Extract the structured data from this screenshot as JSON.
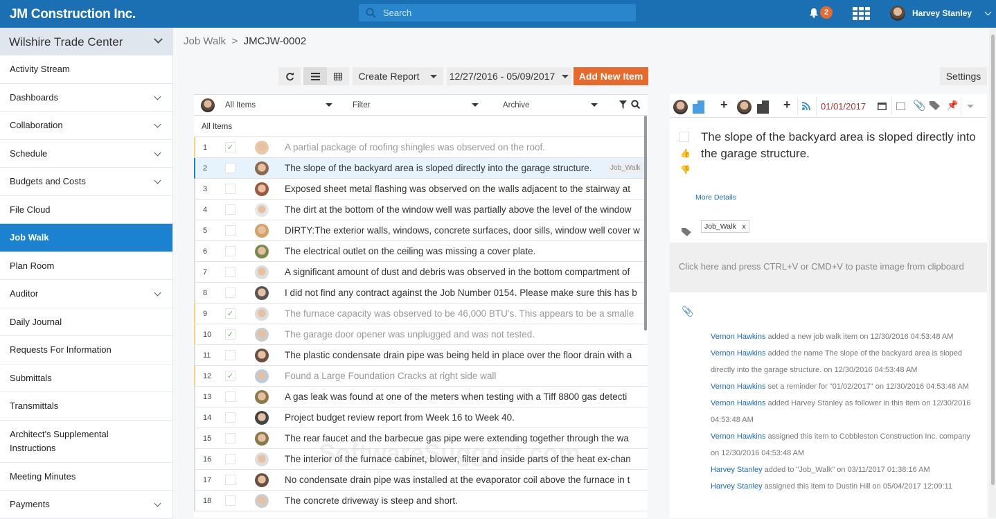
{
  "header": {
    "company": "JM Construction Inc.",
    "search_placeholder": "Search",
    "notifications": "2",
    "user": "Harvey Stanley"
  },
  "sidebar": {
    "project": "Wilshire Trade Center",
    "items": [
      {
        "label": "Activity Stream",
        "chev": false
      },
      {
        "label": "Dashboards",
        "chev": true
      },
      {
        "label": "Collaboration",
        "chev": true
      },
      {
        "label": "Schedule",
        "chev": true
      },
      {
        "label": "Budgets and Costs",
        "chev": true
      },
      {
        "label": "File Cloud",
        "chev": false
      },
      {
        "label": "Job Walk",
        "chev": false,
        "active": true
      },
      {
        "label": "Plan Room",
        "chev": false
      },
      {
        "label": "Auditor",
        "chev": true
      },
      {
        "label": "Daily Journal",
        "chev": false
      },
      {
        "label": "Requests For Information",
        "chev": false
      },
      {
        "label": "Submittals",
        "chev": false
      },
      {
        "label": "Transmittals",
        "chev": false
      },
      {
        "label": "Architect's Supplemental Instructions",
        "chev": false
      },
      {
        "label": "Meeting Minutes",
        "chev": false
      },
      {
        "label": "Payments",
        "chev": true
      }
    ]
  },
  "breadcrumb": {
    "parent": "Job Walk",
    "sep": ">",
    "current": "JMCJW-0002"
  },
  "toolbar": {
    "create_report": "Create Report",
    "date_range": "12/27/2016 - 05/09/2017",
    "add_new": "Add New Item",
    "settings": "Settings"
  },
  "list": {
    "filter1": "All Items",
    "filter2": "Filter",
    "filter3": "Archive",
    "group": "All Items",
    "rows": [
      {
        "n": "1",
        "done": true,
        "text": "A partial package of roofing shingles was observed on the roof."
      },
      {
        "n": "2",
        "done": false,
        "sel": true,
        "text": "The slope of the backyard area is sloped directly into the garage structure.",
        "tag": "Job_Walk"
      },
      {
        "n": "3",
        "done": false,
        "text": "Exposed sheet metal flashing was observed on the walls adjacent to the stairway at"
      },
      {
        "n": "4",
        "done": false,
        "text": "The dirt at the bottom of the window well was partially above the level of the window"
      },
      {
        "n": "5",
        "done": false,
        "text": "DIRTY:The exterior walls, windows, concrete surfaces, door sills, window well cover w"
      },
      {
        "n": "6",
        "done": false,
        "text": "The electrical outlet on the ceiling was missing a cover plate."
      },
      {
        "n": "7",
        "done": false,
        "text": "A significant amount of dust and debris was observed in the bottom compartment of"
      },
      {
        "n": "8",
        "done": false,
        "text": "I did not find any contract against the Job Number 0154. Please make sure this has b"
      },
      {
        "n": "9",
        "done": true,
        "text": "The furnace capacity was observed to be 46,000 BTU's. This appears to be a smalle"
      },
      {
        "n": "10",
        "done": true,
        "text": "The garage door opener was unplugged and was not tested."
      },
      {
        "n": "11",
        "done": false,
        "text": "The plastic condensate drain pipe was being held in place over the floor drain with a"
      },
      {
        "n": "12",
        "done": true,
        "text": "Found a Large Foundation Cracks at right side wall"
      },
      {
        "n": "13",
        "done": false,
        "text": "A gas leak was found at one of the meters when testing with a Tiff 8800 gas detecti"
      },
      {
        "n": "14",
        "done": false,
        "text": "Project budget review report from Week 16 to Week 40."
      },
      {
        "n": "15",
        "done": false,
        "text": "The rear faucet and the barbecue gas pipe were extending together through the wa"
      },
      {
        "n": "16",
        "done": false,
        "text": "The interior of the furnace cabinet, blower, filter and inside parts of the heat ex-chan"
      },
      {
        "n": "17",
        "done": false,
        "text": "No condensate drain pipe was installed at the evaporator coil above the furnace in t"
      },
      {
        "n": "18",
        "done": false,
        "text": "The concrete driveway is steep and short."
      }
    ]
  },
  "detail": {
    "date": "01/01/2017",
    "title": "The slope of the backyard area is sloped directly into the garage structure.",
    "more": "More Details",
    "tag": "Job_Walk",
    "tag_remove": "x",
    "paste": "Click here and press CTRL+V or CMD+V to paste image from clipboard",
    "log": [
      {
        "who": "Vernon Hawkins",
        "what": " added a new job walk item on 12/30/2016 04:53:48 AM"
      },
      {
        "who": "Vernon Hawkins",
        "what": " added the name The slope of the backyard area is sloped directly into the garage structure. on 12/30/2016 04:53:48 AM"
      },
      {
        "who": "Vernon Hawkins",
        "what": " set a reminder for \"01/02/2017\" on 12/30/2016 04:53:48 AM"
      },
      {
        "who": "Vernon Hawkins",
        "what": " added Harvey Stanley as follower in this item on 12/30/2016 04:53:48 AM"
      },
      {
        "who": "Vernon Hawkins",
        "what": " assigned this item to Cobbleston Construction Inc. company on 12/30/2016 04:53:48 AM"
      },
      {
        "who": "Harvey Stanley",
        "what": " added to \"Job_Walk\" on 03/11/2017 01:38:16 AM"
      },
      {
        "who": "Harvey Stanley",
        "what": " assigned this item to Dustin Hill on 05/04/2017 12:09:11"
      }
    ]
  },
  "watermark": "SoftwareSuggest.com"
}
